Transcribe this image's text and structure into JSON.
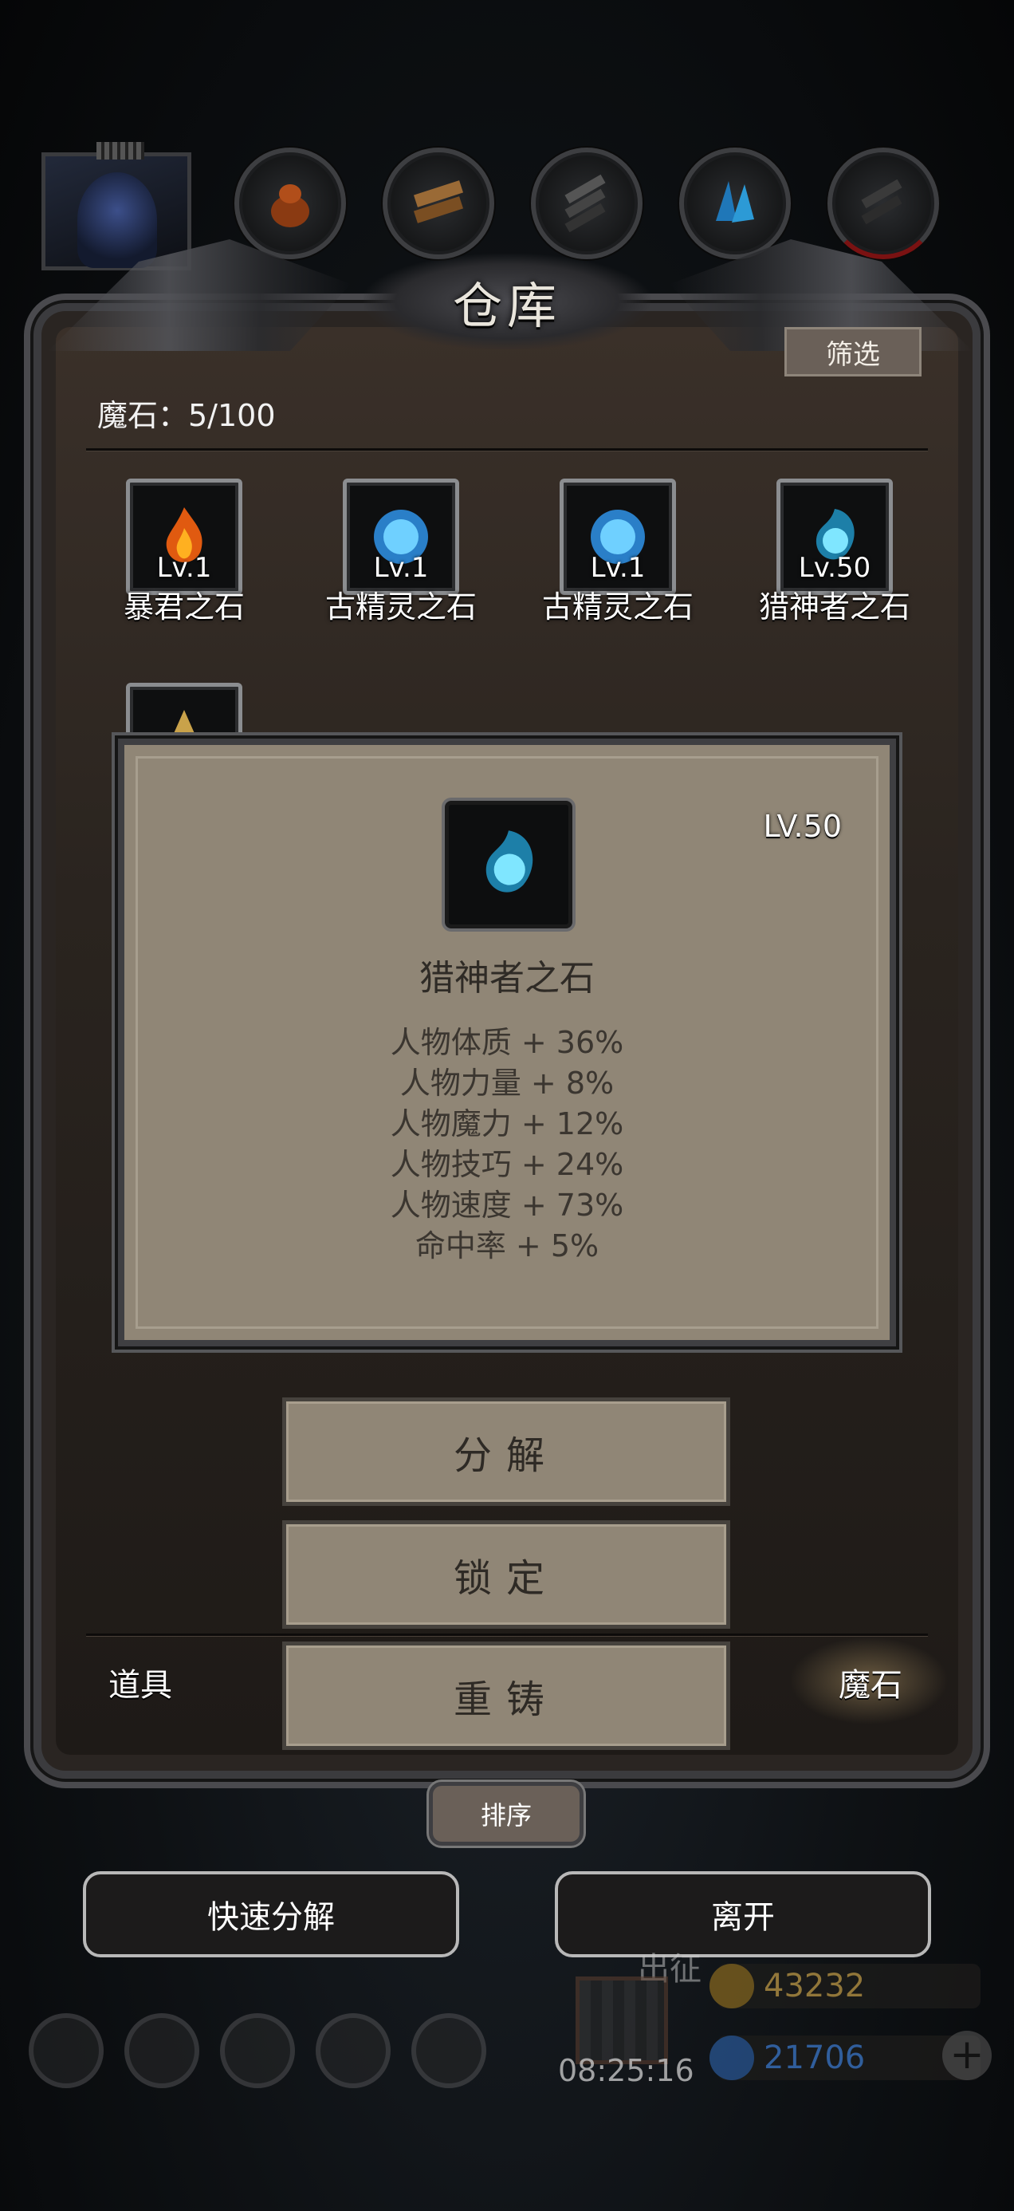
{
  "window": {
    "title": "仓库"
  },
  "toolbar": {
    "filter_label": "筛选"
  },
  "inventory": {
    "count_label": "魔石：5/100",
    "items": [
      {
        "level": "Lv.1",
        "name": "暴君之石",
        "icon": "fire-stone-icon"
      },
      {
        "level": "Lv.1",
        "name": "古精灵之石",
        "icon": "spirit-orb-icon"
      },
      {
        "level": "Lv.1",
        "name": "古精灵之石",
        "icon": "spirit-orb-icon"
      },
      {
        "level": "Lv.50",
        "name": "猎神者之石",
        "icon": "hunter-orb-icon"
      },
      {
        "level": "",
        "name": "",
        "icon": "golden-stone-icon"
      }
    ]
  },
  "detail": {
    "level": "LV.50",
    "name": "猎神者之石",
    "icon": "hunter-orb-icon",
    "stats": [
      "人物体质 + 36%",
      "人物力量 + 8%",
      "人物魔力 + 12%",
      "人物技巧 + 24%",
      "人物速度 + 73%",
      "命中率 + 5%"
    ]
  },
  "actions": {
    "decompose": "分解",
    "lock": "锁定",
    "reforge": "重铸"
  },
  "tabs": {
    "items": "道具",
    "magic_stones": "魔石",
    "active": "魔石"
  },
  "sort_label": "排序",
  "bottom": {
    "quick_decompose": "快速分解",
    "leave": "离开"
  },
  "hud": {
    "expedition": "出征",
    "timer": "08:25:16",
    "gold": "43232",
    "diamonds": "21706"
  },
  "colors": {
    "panel_parchment": "#908676",
    "filter_button": "#6a6058",
    "gold_text": "#c9a24a",
    "diamond_text": "#3f7fd6"
  }
}
